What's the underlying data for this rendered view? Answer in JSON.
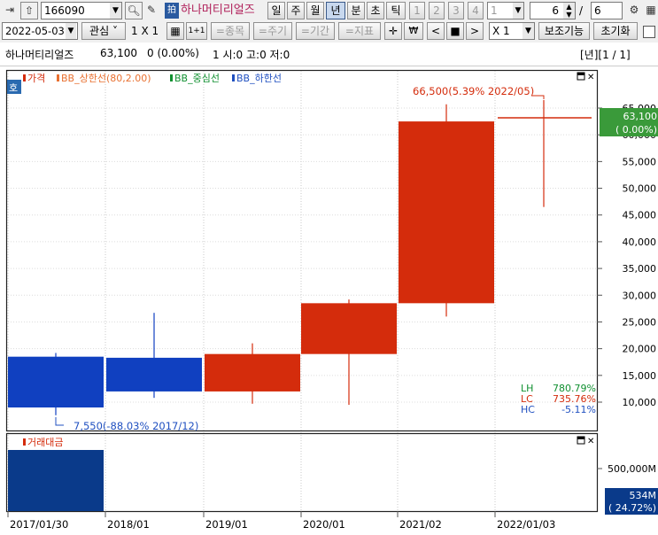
{
  "toolbar1": {
    "code": "166090",
    "name": "하나머티리얼즈",
    "periods": [
      "일",
      "주",
      "월",
      "년",
      "분",
      "초",
      "틱"
    ],
    "active_period": "년",
    "pages": [
      "1",
      "2",
      "3",
      "4"
    ],
    "page_select": "1",
    "count": "6",
    "total": "6"
  },
  "toolbar2": {
    "date": "2022-05-03",
    "watch": "관심",
    "grid": "1 X 1",
    "btn_11": "1+1",
    "btn_stock": "=종목",
    "btn_period": "=주기",
    "btn_term": "=기간",
    "btn_indicator": "=지표",
    "mult": "X 1",
    "aux": "보조기능",
    "reset": "초기화"
  },
  "info": {
    "name": "하나머티리얼즈",
    "price": "63,100",
    "change": "0 (0.00%)",
    "ohlc": "1 시:0 고:0 저:0",
    "period_page": "[년][1 / 1]"
  },
  "colors": {
    "up": "#d42c0c",
    "down": "#1040c0",
    "volume": "#0a3a8a",
    "upper": "#e87030",
    "middle": "#109030",
    "lower": "#2050c0"
  },
  "price_chart": {
    "flag_text": "호",
    "legend": [
      {
        "label": "가격",
        "color": "#d42c0c"
      },
      {
        "label": "BB_상한선(80,2.00)",
        "color": "#e87030"
      },
      {
        "label": "BB_중심선",
        "color": "#109030"
      },
      {
        "label": "BB_하한선",
        "color": "#2050c0"
      }
    ],
    "max_annotation": "66,500(5.39% 2022/05)",
    "min_annotation": "7,550(-88.03% 2017/12)",
    "current_label": "63,100",
    "current_change": "( 0.00%)",
    "stats": [
      {
        "key": "LH",
        "value": "780.79%",
        "color": "#109030"
      },
      {
        "key": "LC",
        "value": "735.76%",
        "color": "#d42c0c"
      },
      {
        "key": "HC",
        "value": "-5.11%",
        "color": "#2050c0"
      }
    ]
  },
  "volume_chart": {
    "legend": "거래대금",
    "axis_label": "500,000M",
    "current_label": "534M",
    "current_change": "( 24.72%)"
  },
  "chart_data": [
    {
      "type": "candlestick",
      "x_labels": [
        "2017/01/30",
        "2018/01",
        "2019/01",
        "2020/01",
        "2021/02",
        "2022/01/03"
      ],
      "candles": [
        {
          "open": 9000,
          "close": 18500,
          "high": 19200,
          "low": 7550,
          "dir": "down"
        },
        {
          "open": 18300,
          "close": 12000,
          "high": 26700,
          "low": 10800,
          "dir": "down"
        },
        {
          "open": 12000,
          "close": 19000,
          "high": 21000,
          "low": 9700,
          "dir": "up"
        },
        {
          "open": 19000,
          "close": 28500,
          "high": 29200,
          "low": 9500,
          "dir": "up"
        },
        {
          "open": 28500,
          "close": 62500,
          "high": 65700,
          "low": 26000,
          "dir": "up"
        },
        {
          "open": 62600,
          "close": 63100,
          "high": 66500,
          "low": 46500,
          "dir": "up"
        }
      ],
      "y_ticks": [
        10000,
        15000,
        20000,
        25000,
        30000,
        35000,
        40000,
        45000,
        50000,
        55000,
        60000,
        65000
      ],
      "ylim": [
        5000,
        68000
      ]
    },
    {
      "type": "bar",
      "title": "거래대금",
      "values": [
        720000,
        0,
        0,
        0,
        0,
        534
      ],
      "unit": "M",
      "y_ticks": [
        500000
      ]
    }
  ]
}
